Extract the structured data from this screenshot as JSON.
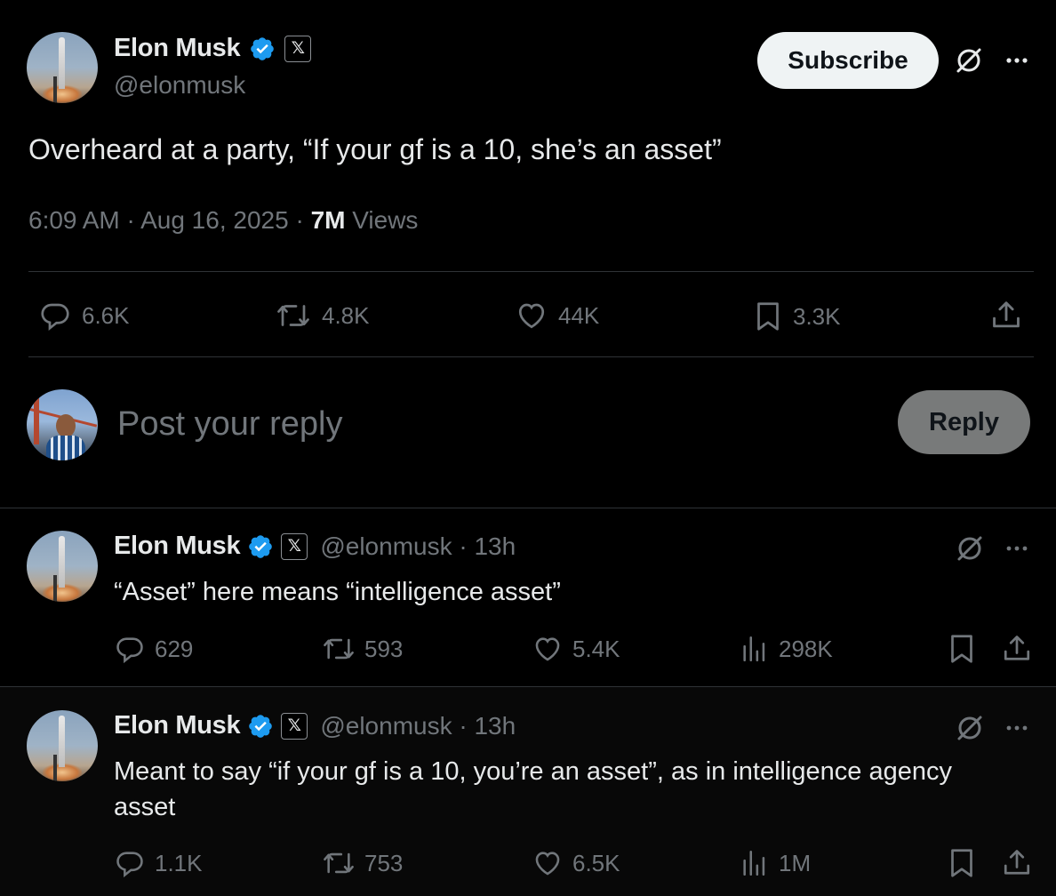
{
  "main_tweet": {
    "author_name": "Elon Musk",
    "handle": "@elonmusk",
    "x_badge": "𝕏",
    "subscribe_label": "Subscribe",
    "text": "Overheard at a party, “If your gf is a 10, she’s an asset”",
    "time": "6:09 AM",
    "date": "Aug 16, 2025",
    "separator": "·",
    "views_count": "7M",
    "views_label": "Views",
    "stats": {
      "replies": "6.6K",
      "reposts": "4.8K",
      "likes": "44K",
      "bookmarks": "3.3K"
    }
  },
  "reply_composer": {
    "placeholder": "Post your reply",
    "button_label": "Reply"
  },
  "replies": [
    {
      "author_name": "Elon Musk",
      "handle_time": "@elonmusk · 13h",
      "x_badge": "𝕏",
      "text": "“Asset” here means “intelligence asset”",
      "stats": {
        "replies": "629",
        "reposts": "593",
        "likes": "5.4K",
        "views": "298K"
      }
    },
    {
      "author_name": "Elon Musk",
      "handle_time": "@elonmusk · 13h",
      "x_badge": "𝕏",
      "text": "Meant to say “if your gf is a 10, you’re an asset”, as in intelligence agency asset",
      "stats": {
        "replies": "1.1K",
        "reposts": "753",
        "likes": "6.5K",
        "views": "1M"
      }
    }
  ],
  "colors": {
    "background": "#000000",
    "text": "#e7e9ea",
    "muted": "#71767b",
    "verified_blue": "#1d9bf0",
    "divider": "#2f3336"
  },
  "icons": [
    "verified-badge-icon",
    "x-logo-icon",
    "grok-icon",
    "more-icon",
    "reply-icon",
    "repost-icon",
    "like-icon",
    "bookmark-icon",
    "share-icon",
    "views-icon"
  ]
}
